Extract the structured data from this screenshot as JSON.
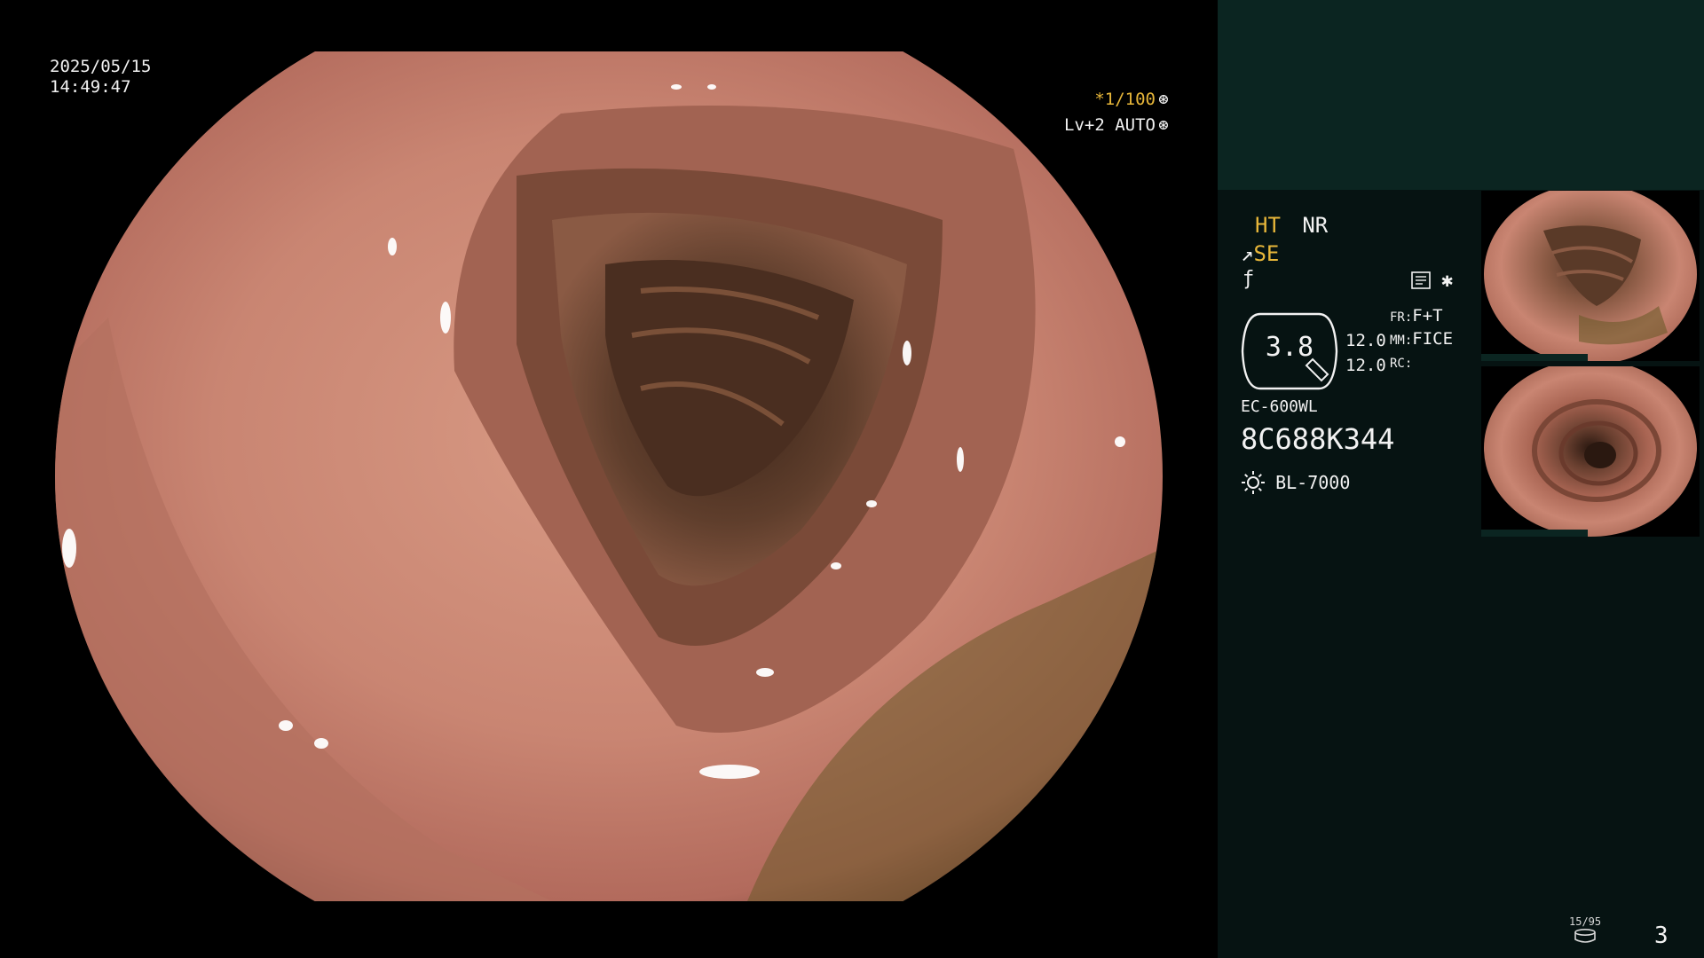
{
  "overlay": {
    "date": "2025/05/15",
    "time": "14:49:47",
    "shutter": "*1/100",
    "level": "Lv+2 AUTO"
  },
  "panel": {
    "ht": "HT",
    "nr": "NR",
    "se": "SE",
    "zoom": "3.8",
    "value_top": "12.0",
    "value_bottom": "12.0",
    "fr_key": "FR:",
    "fr_val": "F+T",
    "mm_key": "MM:",
    "mm_val": "FICE",
    "rc_key": "RC:",
    "scope_model": "EC-600WL",
    "serial": "8C688K344",
    "light_source": "BL-7000"
  },
  "status": {
    "storage": "15/95",
    "page": "3"
  },
  "icons": {
    "shutter": "aperture-icon",
    "auto": "iris-icon",
    "se": "scope-se-icon",
    "f": "function-icon",
    "document": "document-icon",
    "star": "asterisk-icon",
    "light": "sun-icon",
    "storage": "disk-icon"
  },
  "colors": {
    "accent": "#e8b73a",
    "panel": "#061312",
    "panel_top": "#0b2521"
  }
}
